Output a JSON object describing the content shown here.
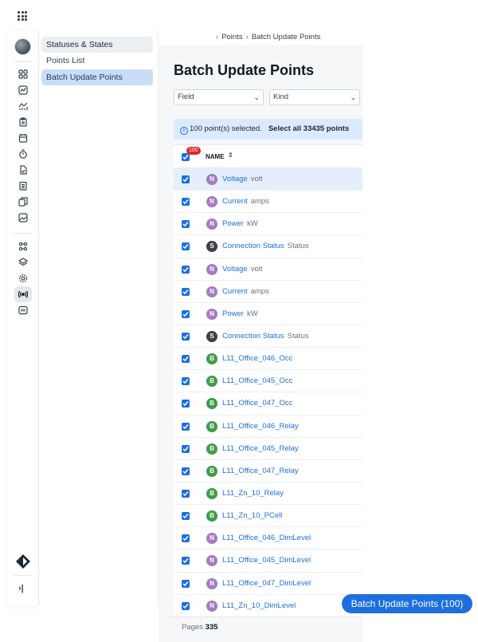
{
  "topbar": {
    "apps_icon": "grid-apps-icon"
  },
  "rail": {
    "icons": [
      "dashboard-icon",
      "chart-icon",
      "analytics-icon",
      "clipboard-icon",
      "calendar-icon",
      "timer-icon",
      "file-icon",
      "list-icon",
      "copy-icon",
      "image-icon",
      "connections-icon",
      "layers-icon",
      "settings-icon",
      "broadcast-icon",
      "integration-icon"
    ],
    "expand_label": "›|"
  },
  "subnav": {
    "items": [
      {
        "label": "Statuses & States"
      },
      {
        "label": "Points List"
      },
      {
        "label": "Batch Update Points"
      }
    ]
  },
  "breadcrumb": {
    "items": [
      "Points",
      "Batch Update Points"
    ]
  },
  "page": {
    "title": "Batch Update Points"
  },
  "filters": {
    "field": {
      "value": "Field"
    },
    "kind": {
      "value": "Kind"
    }
  },
  "banner": {
    "info_icon": "i",
    "selected_text": "100 point(s) selected.",
    "select_all": "Select all 33435 points"
  },
  "table": {
    "header": {
      "name": "NAME",
      "selected_badge": "100",
      "sort_icon": "⌃"
    },
    "rows": [
      {
        "kind": "N",
        "name": "Voltage",
        "unit": "volt"
      },
      {
        "kind": "N",
        "name": "Current",
        "unit": "amps"
      },
      {
        "kind": "N",
        "name": "Power",
        "unit": "kW"
      },
      {
        "kind": "S",
        "name": "Connection Status",
        "unit": "Status"
      },
      {
        "kind": "N",
        "name": "Voltage",
        "unit": "volt"
      },
      {
        "kind": "N",
        "name": "Current",
        "unit": "amps"
      },
      {
        "kind": "N",
        "name": "Power",
        "unit": "kW"
      },
      {
        "kind": "S",
        "name": "Connection Status",
        "unit": "Status"
      },
      {
        "kind": "B",
        "name": "L11_Office_046_Occ",
        "unit": ""
      },
      {
        "kind": "B",
        "name": "L11_Office_045_Occ",
        "unit": ""
      },
      {
        "kind": "B",
        "name": "L11_Office_047_Occ",
        "unit": ""
      },
      {
        "kind": "B",
        "name": "L11_Office_046_Relay",
        "unit": ""
      },
      {
        "kind": "B",
        "name": "L11_Office_045_Relay",
        "unit": ""
      },
      {
        "kind": "B",
        "name": "L11_Office_047_Relay",
        "unit": ""
      },
      {
        "kind": "B",
        "name": "L11_Zn_10_Relay",
        "unit": ""
      },
      {
        "kind": "B",
        "name": "L11_Zn_10_PCell",
        "unit": ""
      },
      {
        "kind": "N",
        "name": "L11_Office_046_DimLevel",
        "unit": ""
      },
      {
        "kind": "N",
        "name": "L11_Office_045_DimLevel",
        "unit": ""
      },
      {
        "kind": "N",
        "name": "L11_Office_047_DimLevel",
        "unit": ""
      },
      {
        "kind": "N",
        "name": "L11_Zn_10_DimLevel",
        "unit": ""
      }
    ]
  },
  "pagination": {
    "label": "Pages",
    "count": "335"
  },
  "action": {
    "batch_update_label": "Batch Update Points (100)"
  },
  "colors": {
    "accent": "#1d6fe0",
    "kind_N": "#a47cc2",
    "kind_S": "#3f3f46",
    "kind_B": "#3f9b4b",
    "badge": "#dc2626"
  }
}
